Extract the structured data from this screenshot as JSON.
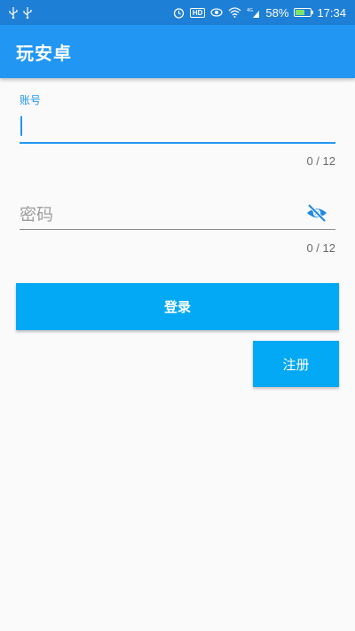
{
  "status_bar": {
    "battery_percent": "58%",
    "battery_level": 0.58,
    "network_label": "4G",
    "time": "17:34",
    "hd_label": "HD",
    "left_icons": [
      "usb-icon",
      "usb-icon"
    ],
    "right_icons": [
      "alarm-icon",
      "hd-icon",
      "eye-icon",
      "wifi-icon",
      "signal-icon",
      "battery-icon"
    ]
  },
  "app_bar": {
    "title": "玩安卓"
  },
  "form": {
    "username": {
      "label": "账号",
      "value": "",
      "counter": "0 / 12"
    },
    "password": {
      "placeholder": "密码",
      "counter": "0 / 12",
      "toggle_icon": "visibility-off-icon"
    },
    "login_label": "登录",
    "register_label": "注册"
  },
  "colors": {
    "status_bar": "#1e7fd6",
    "app_bar": "#2196f3",
    "button": "#03a9f4",
    "background": "#fafafa"
  }
}
